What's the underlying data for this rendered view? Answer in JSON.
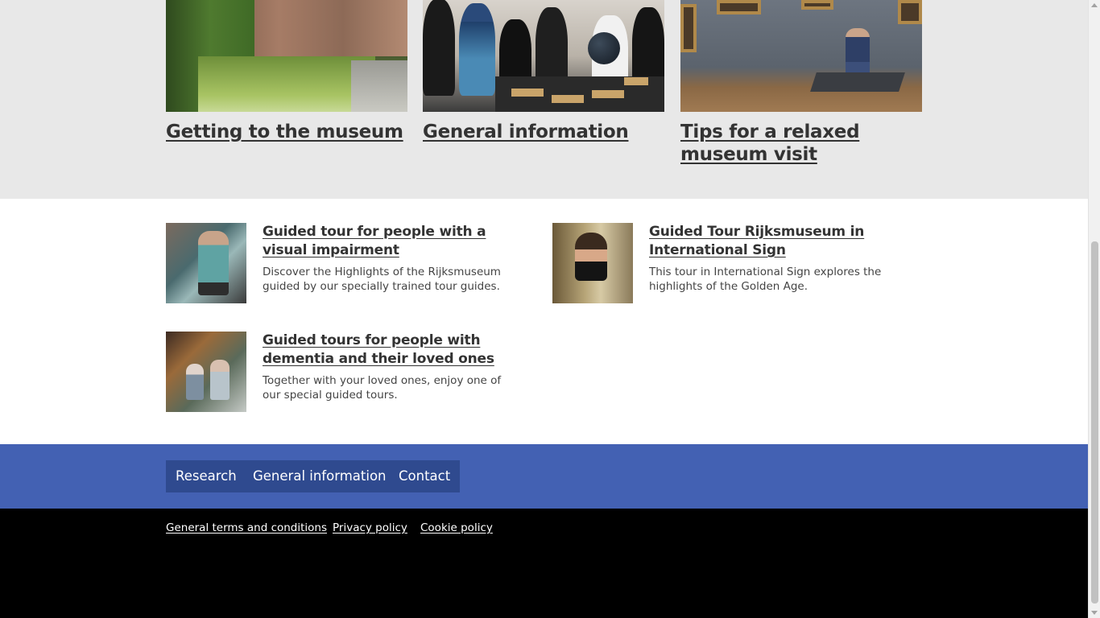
{
  "cards": [
    {
      "title": "Getting to the museum",
      "image": "rijksmuseum-garden-photo"
    },
    {
      "title": "General information",
      "image": "group-viewing-globe-photo"
    },
    {
      "title": "Tips for a relaxed museum visit",
      "image": "gallery-bench-visitor-photo"
    }
  ],
  "tours": [
    {
      "title": "Guided tour for people with a visual impairment",
      "description": "Discover the Highlights of the Rijksmuseum guided by our specially trained tour guides.",
      "image": "visual-impairment-tour-photo"
    },
    {
      "title": "Guided Tour Rijksmuseum in International Sign",
      "description": "This tour in International Sign explores the highlights of the Golden Age.",
      "image": "international-sign-guide-photo"
    },
    {
      "title": "Guided tours for people with dementia and their loved ones",
      "description": "Together with your loved ones, enjoy one of our special guided tours.",
      "image": "dementia-tour-photo"
    }
  ],
  "nav": {
    "research": "Research",
    "general_information": "General information",
    "contact": "Contact"
  },
  "footer": {
    "terms": "General terms and conditions",
    "privacy": "Privacy policy",
    "cookie": "Cookie policy"
  },
  "colors": {
    "cards_bg": "#e8e8e8",
    "nav_bg": "#4361b3",
    "nav_button_bg": "#2f4a8f",
    "footer_bg": "#000000"
  }
}
